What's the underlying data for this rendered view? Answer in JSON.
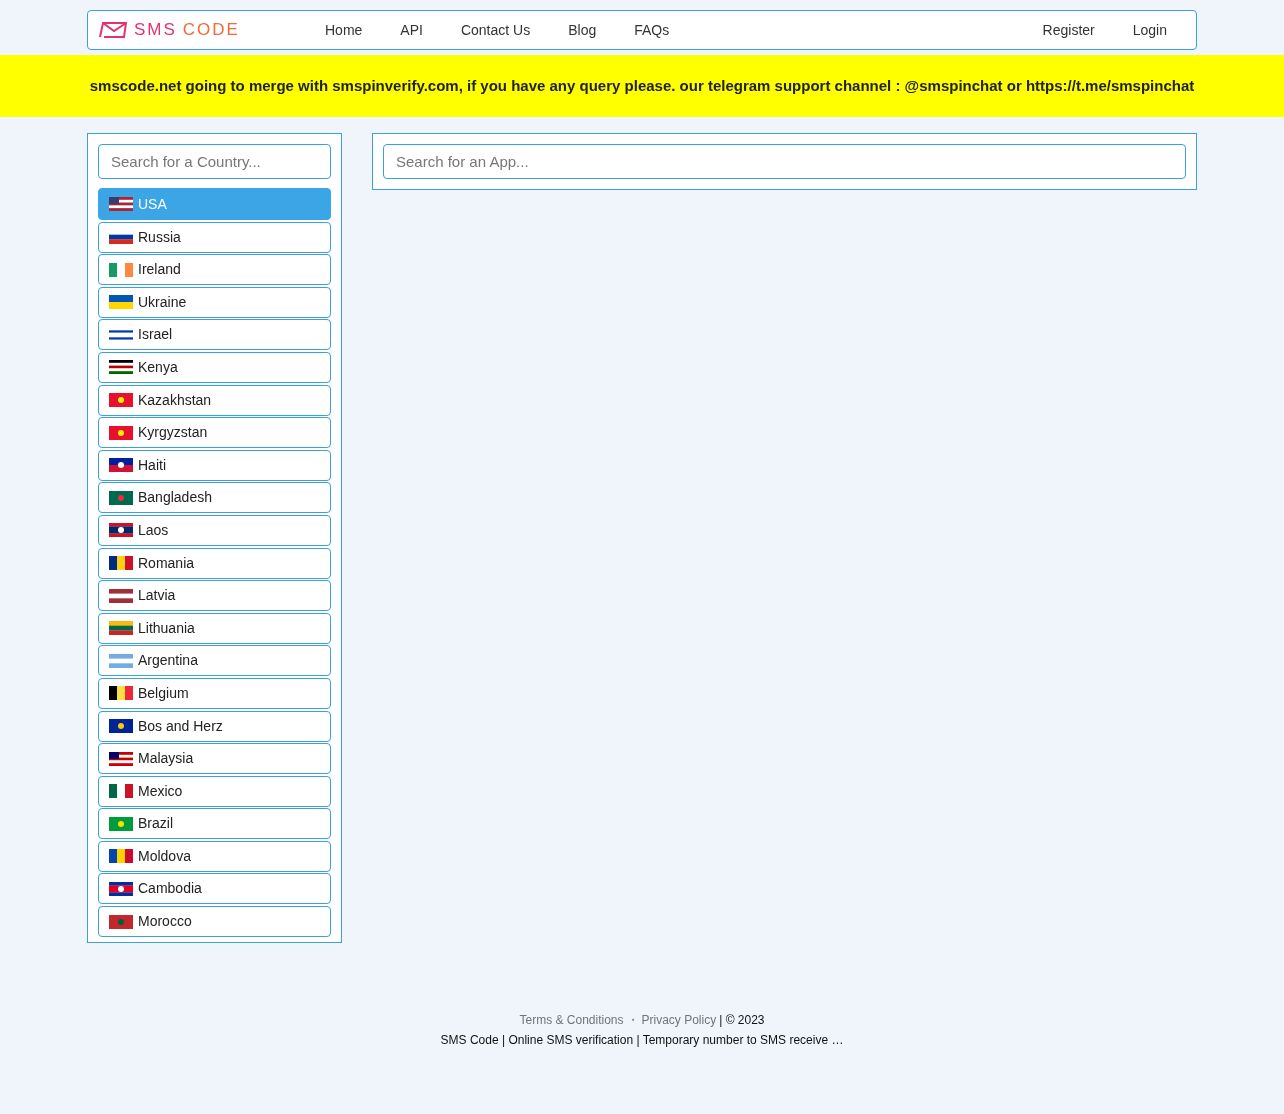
{
  "logo": {
    "text_primary": "SMS",
    "text_secondary": "CODE"
  },
  "nav": {
    "left": [
      {
        "label": "Home"
      },
      {
        "label": "API"
      },
      {
        "label": "Contact Us"
      },
      {
        "label": "Blog"
      },
      {
        "label": "FAQs"
      }
    ],
    "right": [
      {
        "label": "Register"
      },
      {
        "label": "Login"
      }
    ]
  },
  "banner": "smscode.net going to merge with smspinverify.com, if you have any query please. our telegram support channel : @smspinchat or https://t.me/smspinchat",
  "country_search": {
    "placeholder": "Search for a Country..."
  },
  "app_search": {
    "placeholder": "Search for an App..."
  },
  "countries": [
    {
      "name": "USA",
      "selected": true
    },
    {
      "name": "Russia",
      "selected": false
    },
    {
      "name": "Ireland",
      "selected": false
    },
    {
      "name": "Ukraine",
      "selected": false
    },
    {
      "name": "Israel",
      "selected": false
    },
    {
      "name": "Kenya",
      "selected": false
    },
    {
      "name": "Kazakhstan",
      "selected": false
    },
    {
      "name": "Kyrgyzstan",
      "selected": false
    },
    {
      "name": "Haiti",
      "selected": false
    },
    {
      "name": "Bangladesh",
      "selected": false
    },
    {
      "name": "Laos",
      "selected": false
    },
    {
      "name": "Romania",
      "selected": false
    },
    {
      "name": "Latvia",
      "selected": false
    },
    {
      "name": "Lithuania",
      "selected": false
    },
    {
      "name": "Argentina",
      "selected": false
    },
    {
      "name": "Belgium",
      "selected": false
    },
    {
      "name": "Bos and Herz",
      "selected": false
    },
    {
      "name": "Malaysia",
      "selected": false
    },
    {
      "name": "Mexico",
      "selected": false
    },
    {
      "name": "Brazil",
      "selected": false
    },
    {
      "name": "Moldova",
      "selected": false
    },
    {
      "name": "Cambodia",
      "selected": false
    },
    {
      "name": "Morocco",
      "selected": false
    }
  ],
  "footer": {
    "terms": "Terms & Conditions",
    "separator": "・",
    "privacy": "Privacy Policy",
    "copyright": "| © 2023",
    "tagline": "SMS Code | Online SMS verification | Temporary number to SMS receive …"
  }
}
